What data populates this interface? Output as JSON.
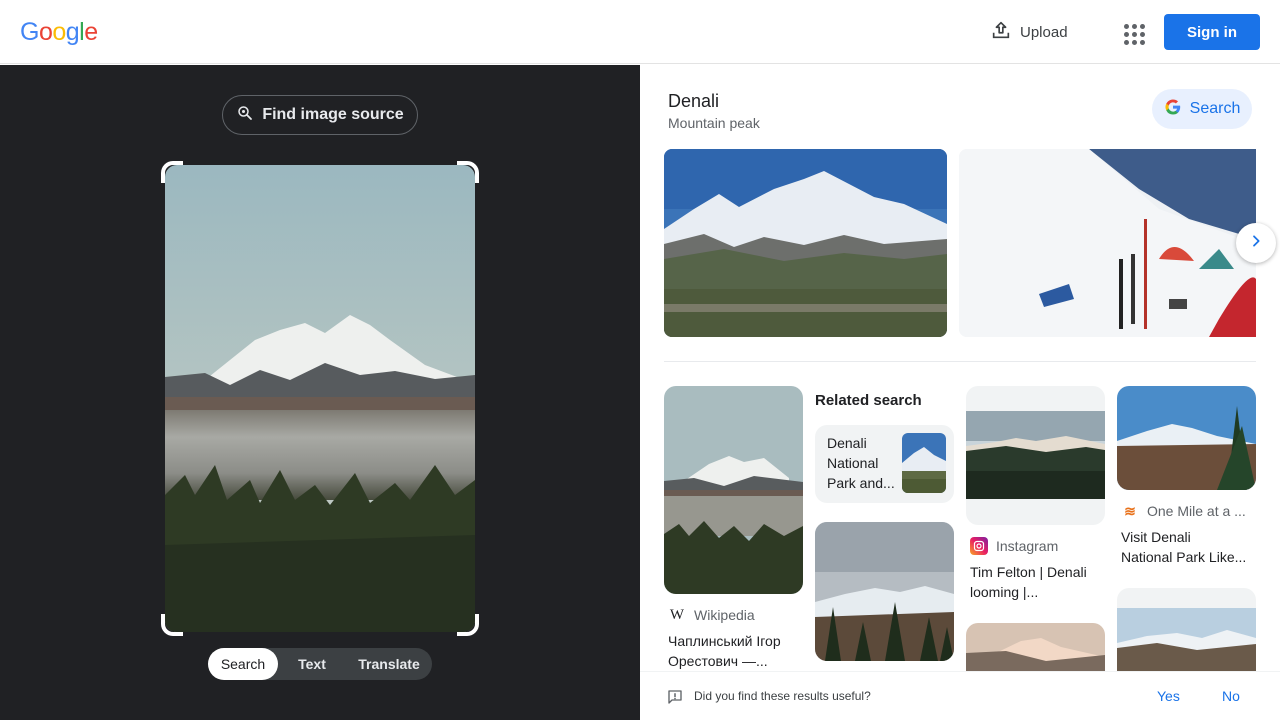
{
  "header": {
    "logo_letters": [
      "G",
      "o",
      "o",
      "g",
      "l",
      "e"
    ],
    "upload_label": "Upload",
    "signin_label": "Sign in"
  },
  "left_panel": {
    "find_source_label": "Find image source",
    "modes": [
      "Search",
      "Text",
      "Translate"
    ],
    "active_mode": "Search"
  },
  "entity": {
    "title": "Denali",
    "subtitle": "Mountain peak",
    "search_label": "Search"
  },
  "results": [
    {
      "source": "Wikipedia",
      "title_lines": [
        "Чаплинський Ігор",
        "Орестович —..."
      ]
    },
    {
      "source": "Instagram",
      "title_lines": [
        "Tim Felton | Denali",
        "looming |..."
      ]
    },
    {
      "source": "One Mile at a ...",
      "title_lines": [
        "Visit Denali",
        "National Park Like..."
      ]
    }
  ],
  "related": {
    "label": "Related search",
    "card_lines": [
      "Denali",
      "National",
      "Park and..."
    ]
  },
  "feedback": {
    "question": "Did you find these results useful?",
    "yes": "Yes",
    "no": "No"
  },
  "colors": {
    "brand_blue": "#1a73e8",
    "left_bg": "#202124",
    "search_pill_bg": "#e8f0fe"
  }
}
